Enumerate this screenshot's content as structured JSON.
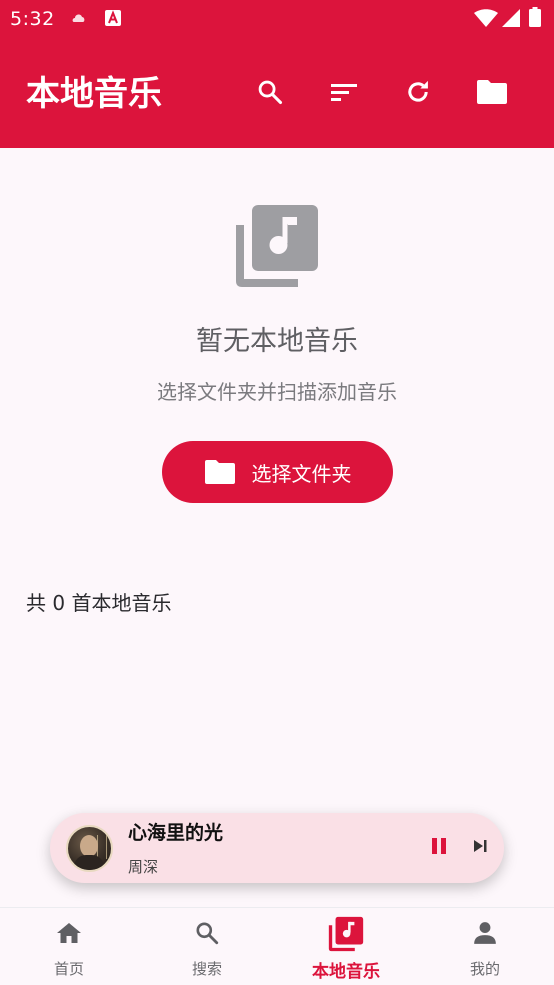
{
  "status_bar": {
    "time": "5:32",
    "icons": [
      "cloud-icon",
      "a-badge-icon",
      "wifi-icon",
      "signal-icon",
      "battery-icon"
    ]
  },
  "app_bar": {
    "title": "本地音乐",
    "actions": [
      "search-icon",
      "sort-icon",
      "refresh-icon",
      "folder-icon"
    ]
  },
  "empty_state": {
    "icon": "music-library-icon",
    "title": "暂无本地音乐",
    "subtitle": "选择文件夹并扫描添加音乐",
    "button_label": "选择文件夹",
    "button_icon": "folder-icon"
  },
  "count_text": "共 0 首本地音乐",
  "mini_player": {
    "title": "心海里的光",
    "artist": "周深",
    "state": "playing"
  },
  "bottom_nav": {
    "items": [
      {
        "label": "首页",
        "icon": "home-icon"
      },
      {
        "label": "搜索",
        "icon": "search-icon"
      },
      {
        "label": "本地音乐",
        "icon": "music-library-icon",
        "active": true
      },
      {
        "label": "我的",
        "icon": "person-icon"
      }
    ]
  },
  "colors": {
    "primary": "#dc143c",
    "background": "#fdf7fb",
    "mini_player_bg": "#fae0e6",
    "empty_icon": "#9e9ea2"
  }
}
